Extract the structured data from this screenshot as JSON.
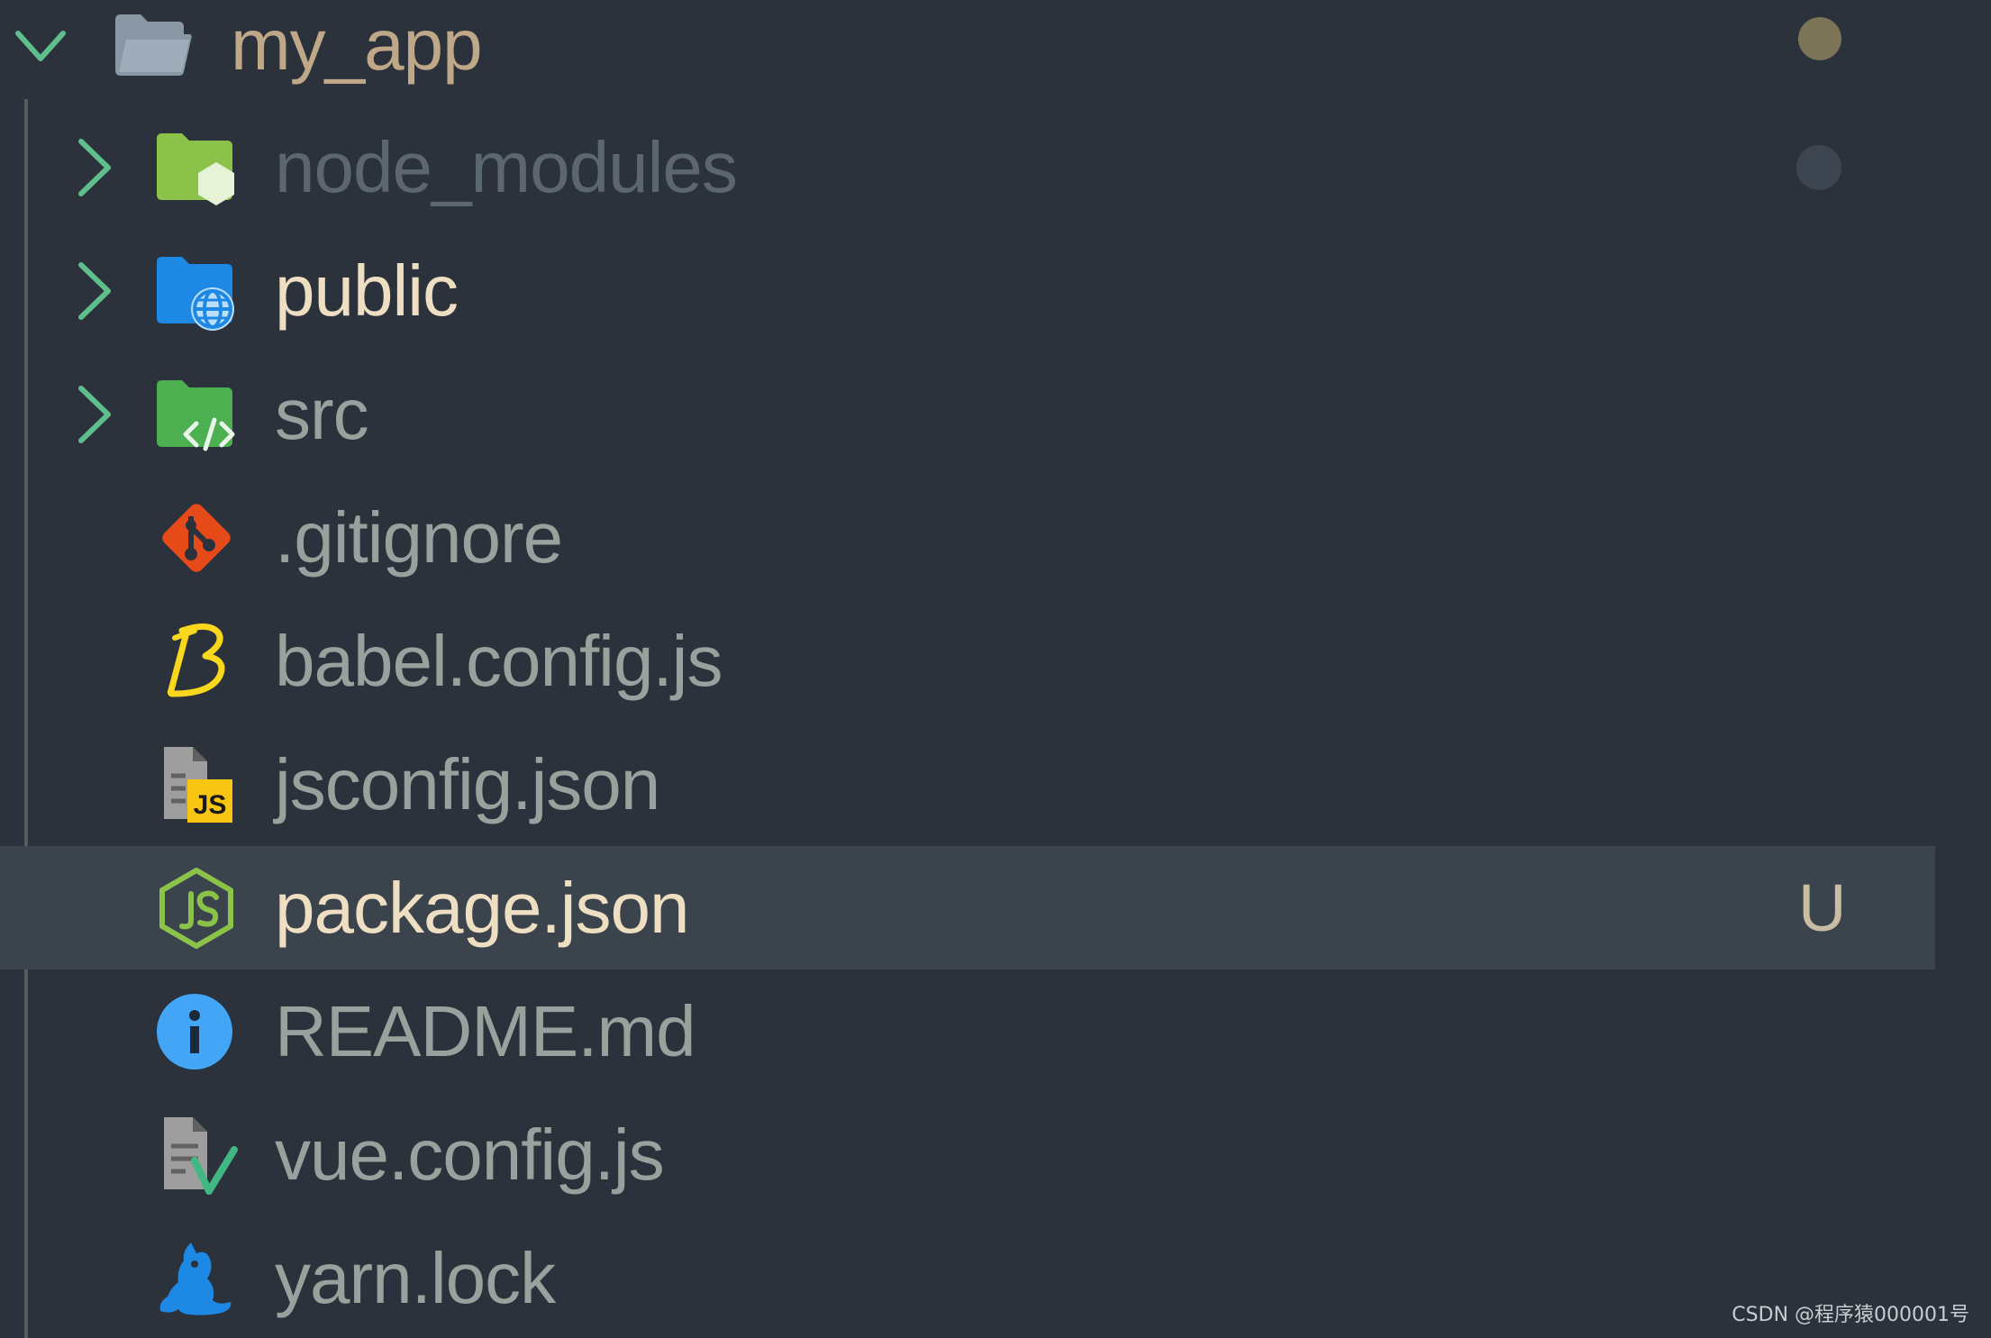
{
  "explorer": {
    "root": {
      "label": "my_app",
      "expanded": true,
      "icon": "folder-open-icon",
      "label_color": "#bfa888",
      "status_color": "#7b7457"
    },
    "items": [
      {
        "label": "node_modules",
        "kind": "folder",
        "icon": "node-folder-icon",
        "label_color": "#5b6670",
        "status": "dot",
        "status_color": "#3d4650"
      },
      {
        "label": "public",
        "kind": "folder",
        "icon": "public-folder-icon",
        "label_color": "#efdfc2"
      },
      {
        "label": "src",
        "kind": "folder",
        "icon": "src-folder-icon",
        "label_color": "#9aa19d"
      },
      {
        "label": ".gitignore",
        "kind": "file",
        "icon": "git-icon",
        "label_color": "#9aa19d"
      },
      {
        "label": "babel.config.js",
        "kind": "file",
        "icon": "babel-icon",
        "label_color": "#9aa19d"
      },
      {
        "label": "jsconfig.json",
        "kind": "file",
        "icon": "jsconfig-icon",
        "label_color": "#9aa19d"
      },
      {
        "label": "package.json",
        "kind": "file",
        "icon": "nodejs-icon",
        "label_color": "#efdfc2",
        "selected": true,
        "status": "letter",
        "status_text": "U",
        "status_color": "#c8bca2"
      },
      {
        "label": "README.md",
        "kind": "file",
        "icon": "info-icon",
        "label_color": "#9aa19d"
      },
      {
        "label": "vue.config.js",
        "kind": "file",
        "icon": "vue-config-icon",
        "label_color": "#9aa19d"
      },
      {
        "label": "yarn.lock",
        "kind": "file",
        "icon": "yarn-icon",
        "label_color": "#9aa19d"
      }
    ]
  },
  "watermark": "CSDN @程序猿000001号",
  "colors": {
    "background": "#2c323b",
    "selection": "#3b434d",
    "chevron": "#5fbf8c",
    "indent_guide": "#555e5e"
  }
}
